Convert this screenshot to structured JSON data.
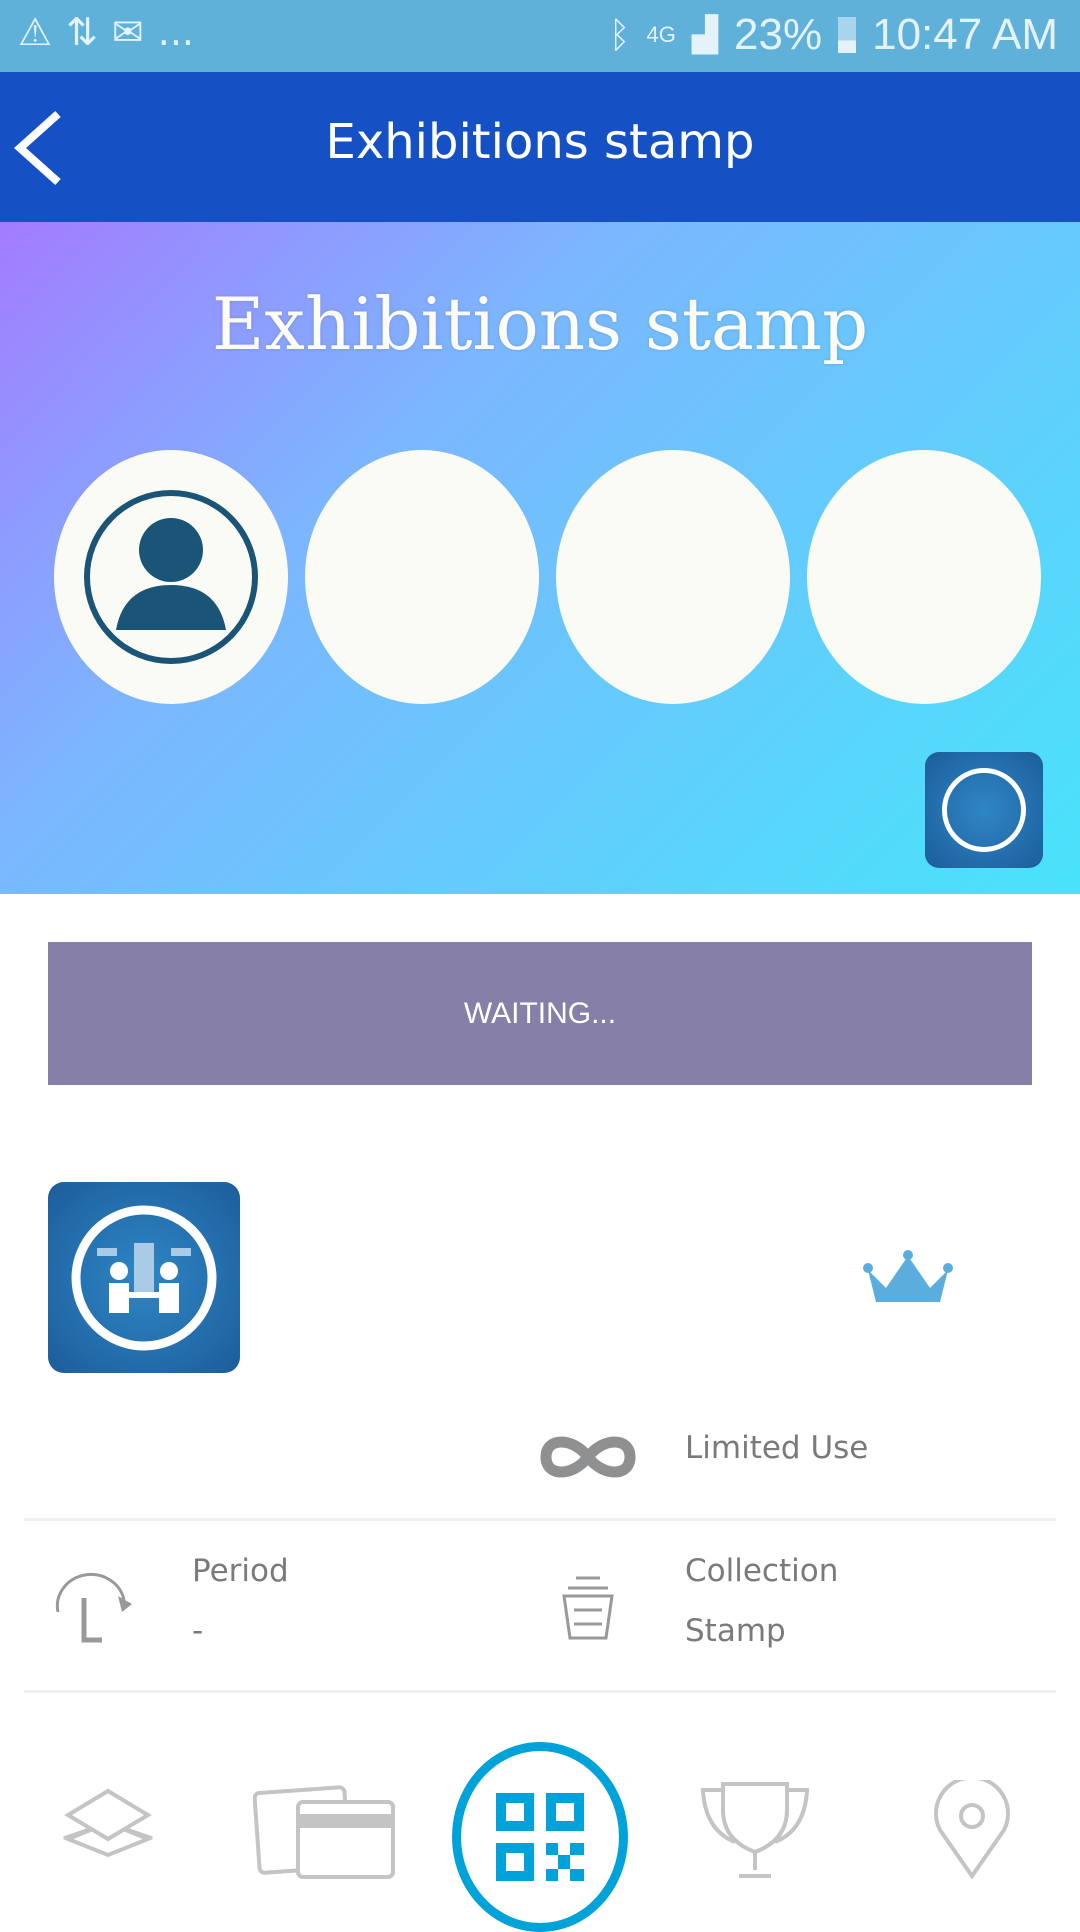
{
  "status_bar": {
    "notifications": [
      "alert-icon",
      "transfer-icon",
      "gmail-icon"
    ],
    "more": "...",
    "network": "4G",
    "battery": "23%",
    "time": "10:47 AM"
  },
  "app_bar": {
    "title": "Exhibitions stamp"
  },
  "banner": {
    "title": "Exhibitions stamp",
    "stamps_total": 4,
    "stamps_collected": 1
  },
  "action": {
    "label": "WAITING..."
  },
  "details": {
    "usage": "Limited Use",
    "period_label": "Period",
    "period_value": "-",
    "type_label": "Collection",
    "type_value": "Stamp"
  },
  "colors": {
    "accent": "#1551c4",
    "button": "#8680a9",
    "nav_active": "#00a3d9",
    "crown": "#5aaddd"
  }
}
